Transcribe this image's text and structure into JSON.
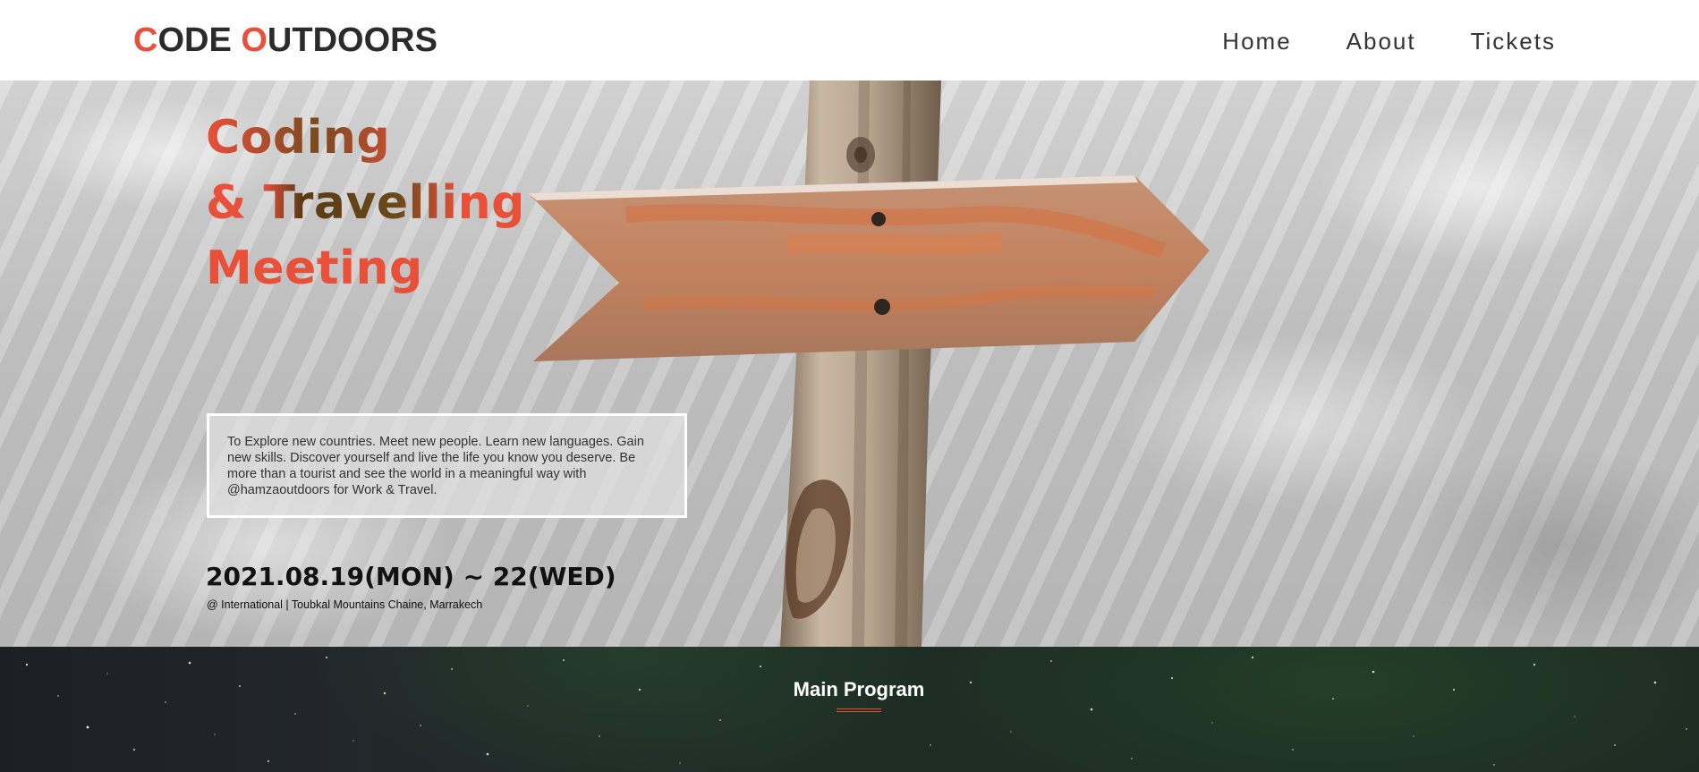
{
  "header": {
    "logo": {
      "first_initial": "C",
      "first_rest": "ODE ",
      "second_initial": "O",
      "second_rest": "UTDOORS"
    },
    "nav": [
      {
        "label": "Home"
      },
      {
        "label": "About"
      },
      {
        "label": "Tickets"
      }
    ]
  },
  "hero": {
    "title_lines": [
      "Coding",
      "& Travelling",
      "Meeting"
    ],
    "intro": "To Explore new countries. Meet new people. Learn new languages. Gain new skills. Discover yourself and live the life you know you deserve. Be more than a tourist and see the world in a meaningful way with @hamzaoutdoors for Work & Travel.",
    "date": "2021.08.19(MON) ~ 22(WED)",
    "location": "@ International | Toubkal Mountains Chaine, Marrakech"
  },
  "program": {
    "title": "Main Program"
  },
  "colors": {
    "accent": "#e8503a",
    "text_dark": "#333333",
    "program_bg": "#1e2a22"
  }
}
